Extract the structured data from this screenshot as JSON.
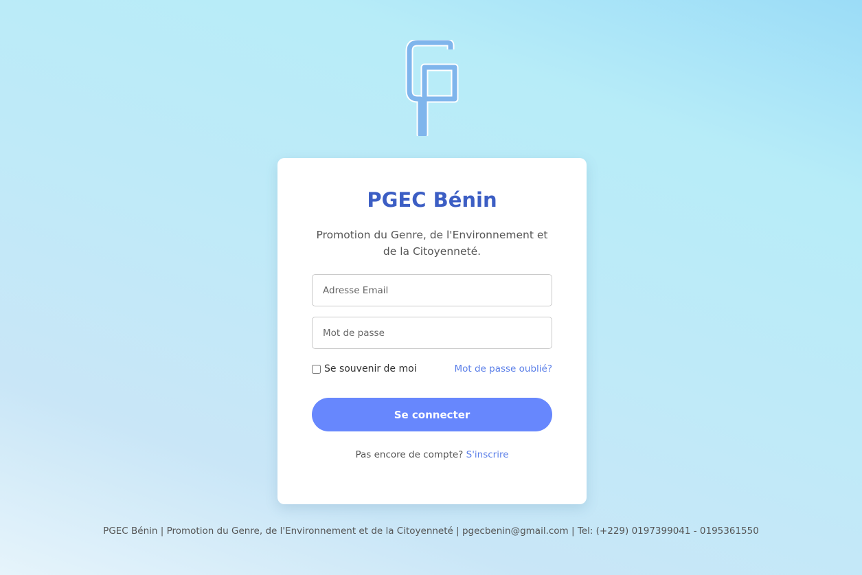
{
  "brand": {
    "logo_icon": "pgec-monogram-logo",
    "title": "PGEC Bénin",
    "subtitle": "Promotion du Genre, de l'Environnement et de la Citoyenneté."
  },
  "form": {
    "email_placeholder": "Adresse Email",
    "password_placeholder": "Mot de passe",
    "remember_label": "Se souvenir de moi",
    "remember_checked": false,
    "forgot_label": "Mot de passe oublié?",
    "submit_label": "Se connecter",
    "signup_prompt": "Pas encore de compte?",
    "signup_label": "S'inscrire"
  },
  "footer": {
    "text": "PGEC Bénin | Promotion du Genre, de l'Environnement et de la Citoyenneté | pgecbenin@gmail.com | Tel: (+229) 0197399041 - 0195361550"
  },
  "colors": {
    "accent": "#6787fd",
    "title": "#3c5ec4",
    "link": "#5b7fe8",
    "logo": "#7fb5ec"
  }
}
